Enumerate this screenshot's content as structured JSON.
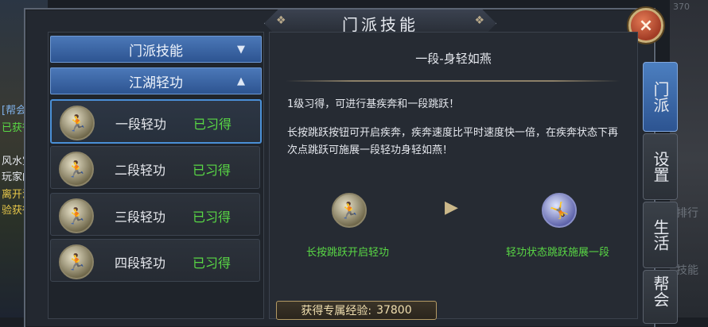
{
  "window": {
    "title": "门派技能",
    "close_icon": "×"
  },
  "left_panel": {
    "category_1": {
      "label": "门派技能",
      "arrow": "▼"
    },
    "category_2": {
      "label": "江湖轻功",
      "arrow": "▲"
    },
    "skills": [
      {
        "name": "一段轻功",
        "status": "已习得",
        "selected": true
      },
      {
        "name": "二段轻功",
        "status": "已习得",
        "selected": false
      },
      {
        "name": "三段轻功",
        "status": "已习得",
        "selected": false
      },
      {
        "name": "四段轻功",
        "status": "已习得",
        "selected": false
      }
    ]
  },
  "detail": {
    "title": "一段-身轻如燕",
    "para1": "1级习得，可进行基疾奔和一段跳跃！",
    "para2": "长按跳跃按钮可开启疾奔，疾奔速度比平时速度快一倍，在疾奔状态下再次点跳跃可施展一段轻功身轻如燕！",
    "step1": "长按跳跃开启轻功",
    "step2": "轻功状态跳跃施展一段",
    "exp_label": "获得专属经验:",
    "exp_value": "37800"
  },
  "side_tabs": [
    {
      "label": "门派",
      "active": true
    },
    {
      "label": "设置",
      "active": false
    },
    {
      "label": "生活",
      "active": false
    },
    {
      "label": "帮会",
      "active": false
    }
  ],
  "background": {
    "chat_lines": [
      "[帮会]",
      "已获得",
      "风水宝",
      "玩家的",
      "离开派",
      "验获得"
    ],
    "ghost_labels": [
      "排行",
      "技能"
    ],
    "badge": "370"
  },
  "colors": {
    "accent_blue": "#2d5491",
    "status_green": "#59d845",
    "gold": "#c9b07a"
  }
}
